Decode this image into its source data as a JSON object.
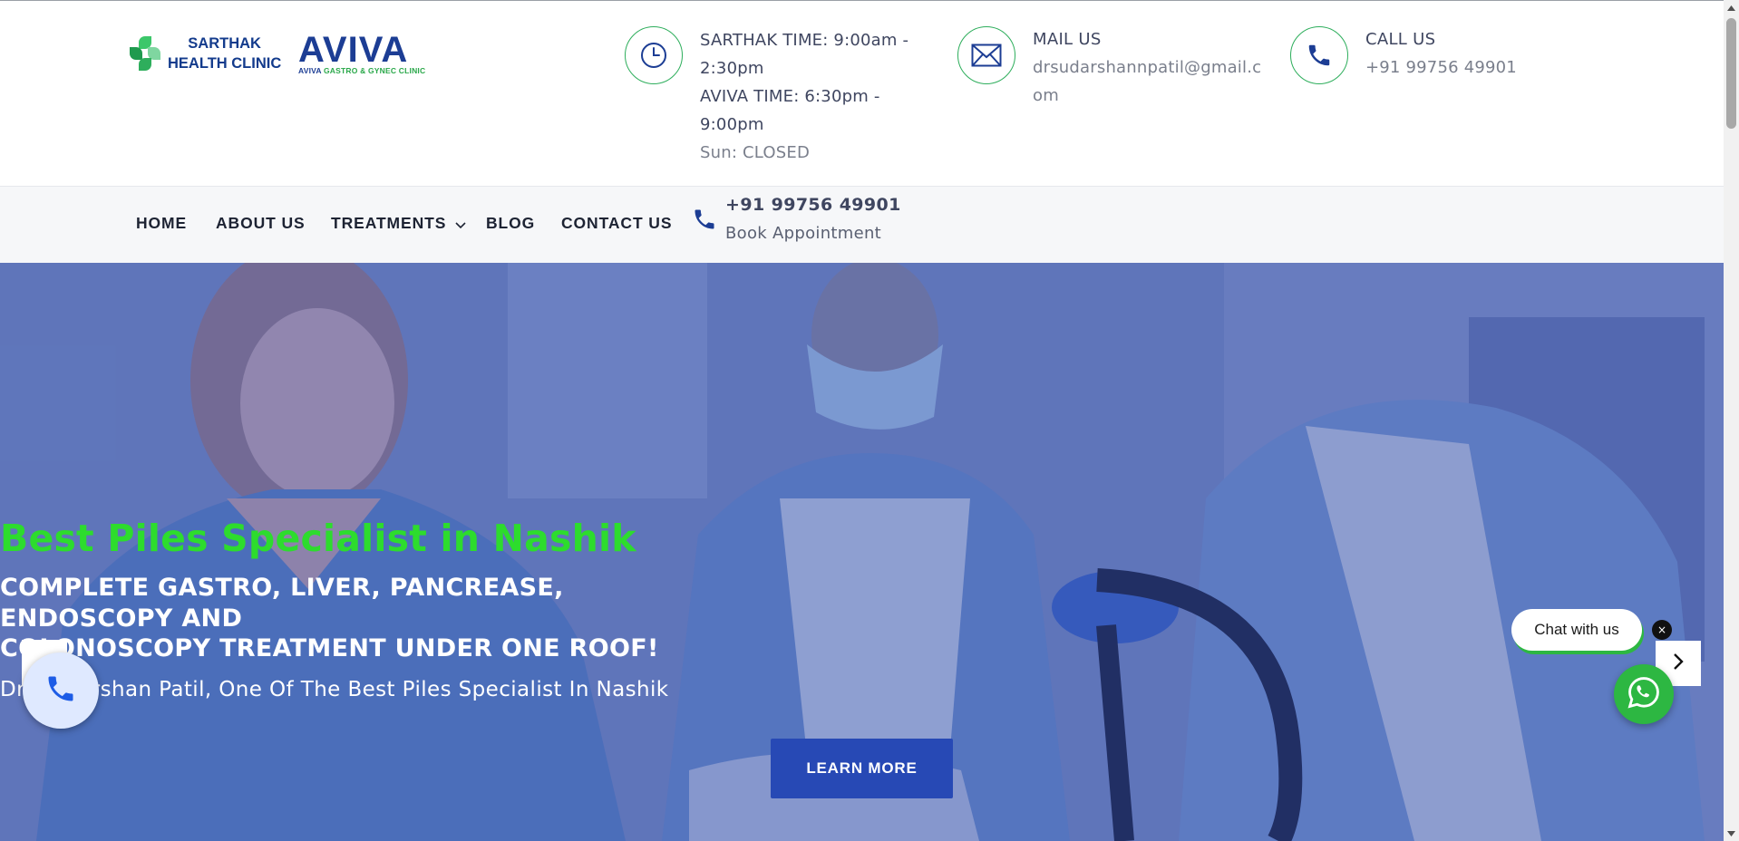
{
  "header": {
    "logo_sarthak_line1": "SARTHAK",
    "logo_sarthak_line2": "HEALTH CLINIC",
    "logo_aviva_word": "AVIVA",
    "logo_aviva_sub_a": "AVIVA",
    "logo_aviva_sub_b": "GASTRO & GYNEC CLINIC",
    "timing": {
      "icon": "clock-icon",
      "line1": "SARTHAK TIME: 9:00am -",
      "line2": "2:30pm",
      "line3": "AVIVA TIME: 6:30pm -",
      "line4": "9:00pm",
      "line5": "Sun: CLOSED"
    },
    "mail": {
      "icon": "mail-icon",
      "title": "MAIL US",
      "line1": "drsudarshannpatil@gmail.c",
      "line2": "om"
    },
    "call": {
      "icon": "phone-icon",
      "title": "CALL US",
      "number": "+91 99756 49901"
    }
  },
  "nav": {
    "items": [
      {
        "label": "HOME"
      },
      {
        "label": "ABOUT US"
      },
      {
        "label": "TREATMENTS"
      },
      {
        "label": "BLOG"
      },
      {
        "label": "CONTACT US"
      }
    ],
    "phone_number": "+91 99756 49901",
    "book_label": "Book Appointment"
  },
  "hero": {
    "heading": "Best Piles Specialist in Nashik",
    "sub_line1": "COMPLETE GASTRO, LIVER, PANCREASE,",
    "sub_line2": "ENDOSCOPY AND",
    "sub_line3": "COLONOSCOPY TREATMENT UNDER ONE ROOF!",
    "description": "Dr. Sudarshan Patil, One Of The Best Piles Specialist In Nashik",
    "button_label": "LEARN MORE"
  },
  "widgets": {
    "chat_label": "Chat with us",
    "chat_close": "×"
  },
  "colors": {
    "brand_green": "#2eae5c",
    "hero_heading": "#2ddc2d",
    "button_blue": "#2749b5",
    "whatsapp": "#2db742",
    "icon_blue": "#1c3d94"
  }
}
